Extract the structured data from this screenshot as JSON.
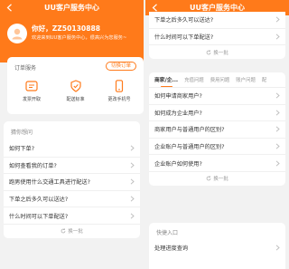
{
  "left": {
    "title": "UU客户服务中心",
    "greeting": "你好，ZZ50130888",
    "subtitle": "欢迎来到UU客户服务中心，很高兴为您服务~",
    "orders": {
      "title": "订单服务",
      "button": "切换订单",
      "services": [
        "发票开取",
        "配送标准",
        "更改手机号"
      ]
    },
    "faq": {
      "title": "猜你想问",
      "items": [
        "如何下单?",
        "如何查看我的订单?",
        "跑男使用什么交通工具进行配送?",
        "下单之后多久可以送达?",
        "什么时间可以下单配送?"
      ],
      "refresh": "换一批"
    }
  },
  "right": {
    "title": "UU客户服务中心",
    "top_list": {
      "items": [
        "下单之后多久可以送达?",
        "什么时间可以下单配送?"
      ],
      "refresh": "换一批"
    },
    "tabs": [
      "商家/企...",
      "充值问题",
      "费用问题",
      "账户问题",
      "配"
    ],
    "tab_list": {
      "items": [
        "如何申请商家用户?",
        "如何成为企业用户?",
        "商家用户与普通用户的区别?",
        "企业账户与普通用户的区别?",
        "企业账户如何使用?"
      ],
      "refresh": "换一批"
    },
    "quick": {
      "title": "快捷入口",
      "items": [
        "处理进度查询"
      ]
    }
  },
  "colors": {
    "accent": "#ff7a1a",
    "background": "#f2f2f2"
  }
}
